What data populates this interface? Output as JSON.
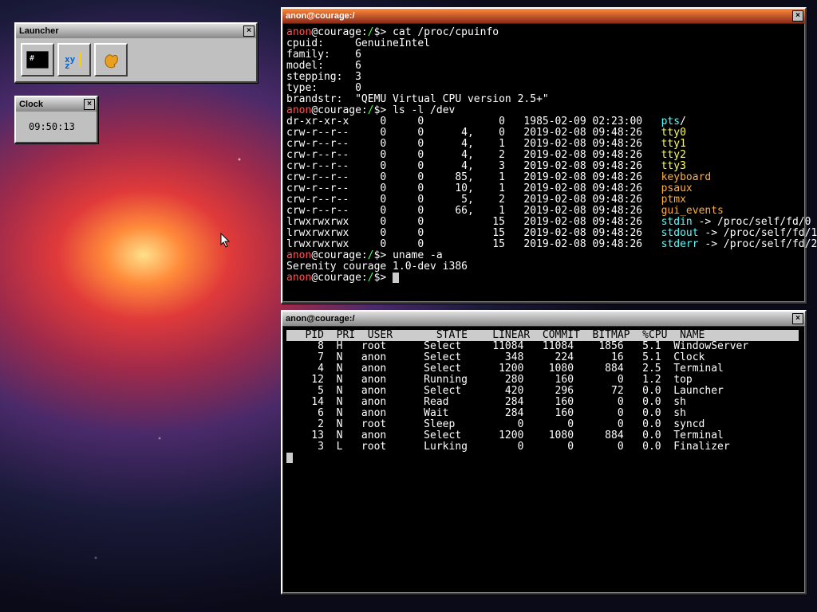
{
  "launcher": {
    "title": "Launcher",
    "icons": [
      "terminal-icon",
      "font-editor-icon",
      "serenity-icon"
    ]
  },
  "clock": {
    "title": "Clock",
    "time": "09:50:13"
  },
  "term1": {
    "title": "anon@courage:/",
    "prompt_user": "anon",
    "prompt_host": "@courage:",
    "prompt_path": "/",
    "prompt_sigil": "$>",
    "cmd1": "cat /proc/cpuinfo",
    "cpuinfo": [
      "cpuid:     GenuineIntel",
      "family:    6",
      "model:     6",
      "stepping:  3",
      "type:      0",
      "brandstr:  \"QEMU Virtual CPU version 2.5+\""
    ],
    "cmd2": "ls -l /dev",
    "ls": [
      {
        "perm": "dr-xr-xr-x",
        "a": "0",
        "b": "0",
        "c": "",
        "d": "0",
        "date": "1985-02-09 02:23:00",
        "name": "pts",
        "suffix": "/",
        "cls": "cyn"
      },
      {
        "perm": "crw-r--r--",
        "a": "0",
        "b": "0",
        "c": "4,",
        "d": "0",
        "date": "2019-02-08 09:48:26",
        "name": "tty0",
        "suffix": "",
        "cls": "yel"
      },
      {
        "perm": "crw-r--r--",
        "a": "0",
        "b": "0",
        "c": "4,",
        "d": "1",
        "date": "2019-02-08 09:48:26",
        "name": "tty1",
        "suffix": "",
        "cls": "yel"
      },
      {
        "perm": "crw-r--r--",
        "a": "0",
        "b": "0",
        "c": "4,",
        "d": "2",
        "date": "2019-02-08 09:48:26",
        "name": "tty2",
        "suffix": "",
        "cls": "yel"
      },
      {
        "perm": "crw-r--r--",
        "a": "0",
        "b": "0",
        "c": "4,",
        "d": "3",
        "date": "2019-02-08 09:48:26",
        "name": "tty3",
        "suffix": "",
        "cls": "yel"
      },
      {
        "perm": "crw-r--r--",
        "a": "0",
        "b": "0",
        "c": "85,",
        "d": "1",
        "date": "2019-02-08 09:48:26",
        "name": "keyboard",
        "suffix": "",
        "cls": "ora"
      },
      {
        "perm": "crw-r--r--",
        "a": "0",
        "b": "0",
        "c": "10,",
        "d": "1",
        "date": "2019-02-08 09:48:26",
        "name": "psaux",
        "suffix": "",
        "cls": "ora"
      },
      {
        "perm": "crw-r--r--",
        "a": "0",
        "b": "0",
        "c": "5,",
        "d": "2",
        "date": "2019-02-08 09:48:26",
        "name": "ptmx",
        "suffix": "",
        "cls": "ora"
      },
      {
        "perm": "crw-r--r--",
        "a": "0",
        "b": "0",
        "c": "66,",
        "d": "1",
        "date": "2019-02-08 09:48:26",
        "name": "gui_events",
        "suffix": "",
        "cls": "ora"
      },
      {
        "perm": "lrwxrwxrwx",
        "a": "0",
        "b": "0",
        "c": "",
        "d": "15",
        "date": "2019-02-08 09:48:26",
        "name": "stdin",
        "suffix": " -> /proc/self/fd/0",
        "cls": "cyn"
      },
      {
        "perm": "lrwxrwxrwx",
        "a": "0",
        "b": "0",
        "c": "",
        "d": "15",
        "date": "2019-02-08 09:48:26",
        "name": "stdout",
        "suffix": " -> /proc/self/fd/1",
        "cls": "cyn"
      },
      {
        "perm": "lrwxrwxrwx",
        "a": "0",
        "b": "0",
        "c": "",
        "d": "15",
        "date": "2019-02-08 09:48:26",
        "name": "stderr",
        "suffix": " -> /proc/self/fd/2",
        "cls": "cyn"
      }
    ],
    "cmd3": "uname -a",
    "uname": "Serenity courage 1.0-dev i386"
  },
  "term2": {
    "title": "anon@courage:/",
    "header": "   PID  PRI  USER       STATE    LINEAR  COMMIT  BITMAP  %CPU  NAME            ",
    "rows": [
      {
        "pid": "8",
        "pri": "H",
        "user": "root",
        "state": "Select",
        "lin": "11084",
        "com": "11084",
        "bmp": "1856",
        "cpu": "5.1",
        "name": "WindowServer"
      },
      {
        "pid": "7",
        "pri": "N",
        "user": "anon",
        "state": "Select",
        "lin": "348",
        "com": "224",
        "bmp": "16",
        "cpu": "5.1",
        "name": "Clock"
      },
      {
        "pid": "4",
        "pri": "N",
        "user": "anon",
        "state": "Select",
        "lin": "1200",
        "com": "1080",
        "bmp": "884",
        "cpu": "2.5",
        "name": "Terminal"
      },
      {
        "pid": "12",
        "pri": "N",
        "user": "anon",
        "state": "Running",
        "lin": "280",
        "com": "160",
        "bmp": "0",
        "cpu": "1.2",
        "name": "top"
      },
      {
        "pid": "5",
        "pri": "N",
        "user": "anon",
        "state": "Select",
        "lin": "420",
        "com": "296",
        "bmp": "72",
        "cpu": "0.0",
        "name": "Launcher"
      },
      {
        "pid": "14",
        "pri": "N",
        "user": "anon",
        "state": "Read",
        "lin": "284",
        "com": "160",
        "bmp": "0",
        "cpu": "0.0",
        "name": "sh"
      },
      {
        "pid": "6",
        "pri": "N",
        "user": "anon",
        "state": "Wait",
        "lin": "284",
        "com": "160",
        "bmp": "0",
        "cpu": "0.0",
        "name": "sh"
      },
      {
        "pid": "2",
        "pri": "N",
        "user": "root",
        "state": "Sleep",
        "lin": "0",
        "com": "0",
        "bmp": "0",
        "cpu": "0.0",
        "name": "syncd"
      },
      {
        "pid": "13",
        "pri": "N",
        "user": "anon",
        "state": "Select",
        "lin": "1200",
        "com": "1080",
        "bmp": "884",
        "cpu": "0.0",
        "name": "Terminal"
      },
      {
        "pid": "3",
        "pri": "L",
        "user": "root",
        "state": "Lurking",
        "lin": "0",
        "com": "0",
        "bmp": "0",
        "cpu": "0.0",
        "name": "Finalizer"
      }
    ]
  }
}
